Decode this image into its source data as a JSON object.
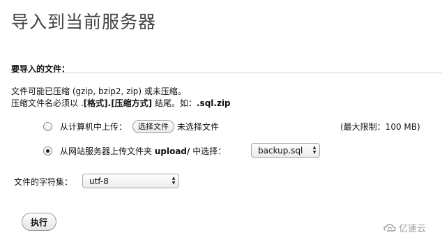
{
  "title": "导入到当前服务器",
  "section": {
    "header": "要导入的文件："
  },
  "info": {
    "line1": "文件可能已压缩 (gzip, bzip2, zip) 或未压缩。",
    "line2_prefix": "压缩文件名必须以 .",
    "line2_format": "[格式]",
    "line2_dot": ".",
    "line2_compress": "[压缩方式]",
    "line2_mid": " 结尾。如：",
    "line2_example": ".sql.zip"
  },
  "upload_computer": {
    "label": "从计算机中上传：",
    "selected": false,
    "choose_button": "选择文件",
    "no_file": "未选择文件",
    "limit": "(最大限制：100 MB)"
  },
  "upload_server": {
    "label_prefix": "从网站服务器上传文件夹 ",
    "folder": "upload/",
    "label_suffix": " 中选择：",
    "selected": true,
    "selected_file": "backup.sql"
  },
  "charset": {
    "label": "文件的字符集：",
    "value": "utf-8"
  },
  "submit_label": "执行",
  "watermark": {
    "text": "亿速云"
  }
}
